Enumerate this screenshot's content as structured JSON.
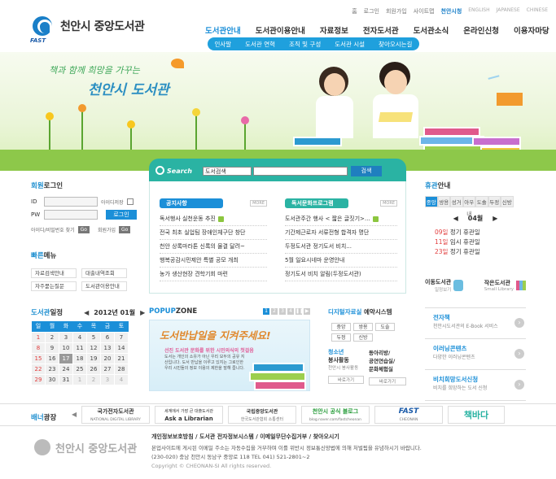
{
  "header": {
    "logo_name": "천안시 중앙도서관",
    "logo_sub": "FAST",
    "util": [
      "홈",
      "로그인",
      "회원가입",
      "사이트맵",
      "천안시청"
    ],
    "langs": [
      "ENGLISH",
      "JAPANESE",
      "CHINESE"
    ],
    "gnb": [
      "도서관안내",
      "도서관이용안내",
      "자료정보",
      "전자도서관",
      "도서관소식",
      "온라인신청",
      "이용자마당"
    ],
    "subnav": [
      "인사말",
      "도서관 연혁",
      "조직 및 구성",
      "도서관 시설",
      "찾아오시는길"
    ]
  },
  "hero": {
    "slogan1": "책과 함께 희망을 가꾸는",
    "slogan2": "천안시 도서관"
  },
  "search": {
    "label": "Search",
    "select_value": "도서검색",
    "button": "검색"
  },
  "login": {
    "title_a": "회원",
    "title_b": "로그인",
    "id_label": "ID",
    "pw_label": "PW",
    "save_id": "아이디저장",
    "login_btn": "로그인",
    "find_label": "아이디/비밀번호 찾기",
    "join_label": "회원가입",
    "go": "Go"
  },
  "quick": {
    "title_a": "빠른",
    "title_b": "메뉴",
    "items": [
      "자료검색안내",
      "대출내역조회",
      "자주묻는질문",
      "도서관이용안내"
    ]
  },
  "calendar": {
    "title_a": "도서관",
    "title_b": "일정",
    "month_label": "2012년 01월",
    "days": [
      "일",
      "월",
      "화",
      "수",
      "목",
      "금",
      "토"
    ],
    "weeks": [
      [
        "1",
        "2",
        "3",
        "4",
        "5",
        "6",
        "7"
      ],
      [
        "8",
        "9",
        "10",
        "11",
        "12",
        "13",
        "14"
      ],
      [
        "15",
        "16",
        "17",
        "18",
        "19",
        "20",
        "21"
      ],
      [
        "22",
        "23",
        "24",
        "25",
        "26",
        "27",
        "28"
      ],
      [
        "29",
        "30",
        "31",
        "1",
        "2",
        "3",
        "4"
      ]
    ],
    "selected": "17"
  },
  "notice": {
    "title": "공지사항",
    "more": "MORE",
    "items": [
      "독서행사 실천운동 추진",
      "전국 최초 실업팀 장애인체구단 창단",
      "천안 상록마라톤 신록의 물결 달려~",
      "행복공감시민제안 특별 공모 개최",
      "농가 생산현장 견학기회 마련"
    ]
  },
  "culture": {
    "title": "독서문화프로그램",
    "more": "MORE",
    "items": [
      "도서관주간 행사 < 짧은 글짓기>...",
      "기간제근로자 서류전형 합격자 명단",
      "두정도서관 정기도서 비치...",
      "5월 일요시네마 운영안내",
      "정기도서 비치 알림(두정도서관)"
    ]
  },
  "closed": {
    "title_a": "휴관",
    "title_b": "안내",
    "tabs": [
      "중앙",
      "쌍용",
      "성거",
      "아우내",
      "도솔",
      "두정",
      "신방"
    ],
    "month": "04월",
    "items": [
      {
        "d": "09일",
        "t": "정기 휴관일"
      },
      {
        "d": "11일",
        "t": "임시 휴관일"
      },
      {
        "d": "23일",
        "t": "정기 휴관일"
      }
    ]
  },
  "guides": [
    {
      "t": "이동도서관",
      "s": "일정보기"
    },
    {
      "t": "작은도서관",
      "s": "Small Library"
    }
  ],
  "popup": {
    "title": "POPUP",
    "title_b": "ZONE",
    "pages": [
      "1",
      "2",
      "3",
      "4"
    ],
    "headline": "도서반납일을 지켜주세요!",
    "sub": "선진 도서관 문화를 위한 시민의식의 첫걸음",
    "body": "도서는 개인의 소유가 아닌 우리 모두의 공유 지산입니다. 도서 반납을 이루고 있지는 그로인한 우리 시민들의 정보 이용의 제한을 말해 줍니다."
  },
  "digital": {
    "title_a": "디지털자료실",
    "title_b": "예약시스템",
    "btns": [
      "중앙",
      "쌍용",
      "도솔",
      "두정",
      "신방"
    ],
    "vol1_title": "청소년",
    "vol1_title2": "봉사활동",
    "vol1_sub": "천안시 봉사활동",
    "vol1_btn": "바로가기",
    "vol2_title": "동아리방/",
    "vol2_title2": "공연연습실/",
    "vol2_title3": "문화체험실",
    "vol2_btn": "바로가기"
  },
  "rightlinks": [
    {
      "t": "전자책",
      "s": "천안시도서관의 E-Book 서비스"
    },
    {
      "t": "이러닝콘텐츠",
      "s": "다양한 이러닝콘텐츠"
    },
    {
      "t": "비치희망도서신청",
      "s": "비치를 희망하는 도서 신청"
    }
  ],
  "banners": {
    "title_a": "배너",
    "title_b": "광장",
    "items": [
      {
        "a": "국가전자도서관",
        "b": "NATIONAL DIGITAL LIBRARY"
      },
      {
        "a": "세계에서 가장 큰 대출도서관",
        "b": "Ask a Librarian"
      },
      {
        "a": "국립중앙도서관",
        "b": "한국도서관협회 소통센터"
      },
      {
        "a": "천안시 공식 블로그",
        "b": "blog.naver.com/fastcheonan"
      },
      {
        "a": "FAST",
        "b": "CHEONAN"
      },
      {
        "a": "책바다",
        "b": ""
      }
    ]
  },
  "footer": {
    "links": "개인정보보호방침 / 도서관 전자정보시스템 / 이메일무단수집거부 / 찾아오시기",
    "line1": "본업사이트에 게시된 이메일 주소는 자동수집을 거부하며 이를 위반시 정보통신망법에 의해 처벌됨을 유념하시기 바랍니다.",
    "line2": "(230-020) 충남 천안시 동남구 중앙로 118  TEL 041) 521-2801~2",
    "copy": "Copyright © CHEONAN-SI All rights reserved.",
    "logo_name": "천안시 중앙도서관"
  },
  "colors": {
    "accent": "#1b8fd8",
    "teal": "#2ab3a3",
    "notice": "#1b8fd8",
    "culture": "#2ab3a3",
    "red": "#e23c3c"
  }
}
